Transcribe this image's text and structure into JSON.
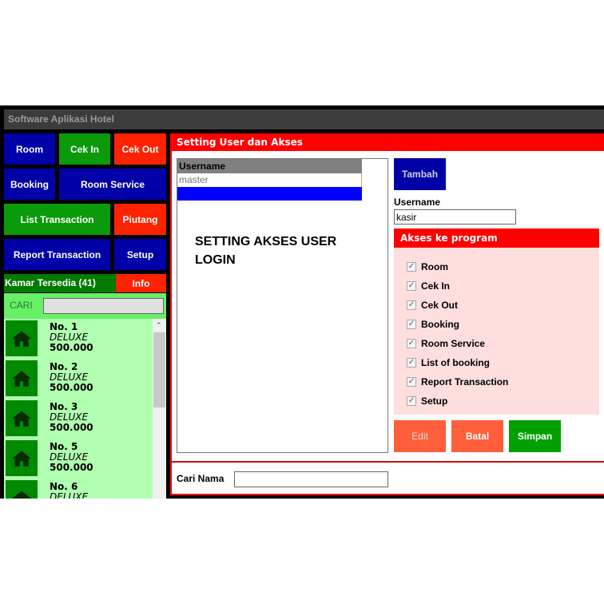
{
  "window": {
    "title": "Software Aplikasi Hotel"
  },
  "menu": [
    {
      "label": "Room",
      "color": "#0000a8"
    },
    {
      "label": "Cek In",
      "color": "#0a9a0a"
    },
    {
      "label": "Cek Out",
      "color": "#ff2200"
    },
    {
      "label": "Booking",
      "color": "#0000a8"
    },
    {
      "label": "Room Service",
      "color": "#0000a8"
    },
    {
      "label": "List Transaction",
      "color": "#0a9a0a"
    },
    {
      "label": "Piutang",
      "color": "#ff2200"
    },
    {
      "label": "Report Transaction",
      "color": "#0000a8"
    },
    {
      "label": "Setup",
      "color": "#0000a8"
    }
  ],
  "sidebar": {
    "available": "Kamar Tersedia (41)",
    "info": "Info",
    "search_label": "CARI",
    "search_value": "",
    "rooms": [
      {
        "number": "No. 1",
        "type": "DELUXE",
        "price": "500.000",
        "icon": "house-icon"
      },
      {
        "number": "No. 2",
        "type": "DELUXE",
        "price": "500.000",
        "icon": "house-icon"
      },
      {
        "number": "No. 3",
        "type": "DELUXE",
        "price": "500.000",
        "icon": "house-icon"
      },
      {
        "number": "No. 5",
        "type": "DELUXE",
        "price": "500.000",
        "icon": "house-icon"
      },
      {
        "number": "No. 6",
        "type": "DELUXE",
        "price": "",
        "icon": "house-icon"
      }
    ]
  },
  "panel": {
    "title": "Setting User dan Akses",
    "list_header": "Username",
    "users": [
      "master"
    ],
    "caption": "SETTING AKSES USER LOGIN",
    "add_label": "Tambah",
    "username_label": "Username",
    "username_value": "kasir",
    "access_title": "Akses ke program",
    "access": [
      {
        "label": "Room",
        "checked": true
      },
      {
        "label": "Cek In",
        "checked": true
      },
      {
        "label": "Cek Out",
        "checked": true
      },
      {
        "label": "Booking",
        "checked": true
      },
      {
        "label": "Room Service",
        "checked": true
      },
      {
        "label": "List of booking",
        "checked": true
      },
      {
        "label": "Report Transaction",
        "checked": true
      },
      {
        "label": "Setup",
        "checked": true
      }
    ],
    "edit_label": "Edit",
    "cancel_label": "Batal",
    "save_label": "Simpan",
    "search_name_label": "Cari Nama",
    "search_name_value": ""
  }
}
